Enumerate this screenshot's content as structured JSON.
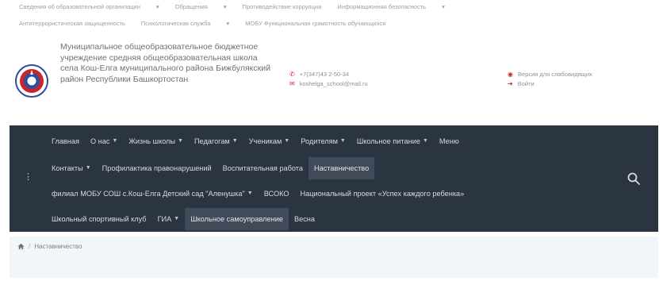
{
  "top_links": {
    "row1": [
      "Сведения об образовательной организации",
      "Обращения",
      "Противодействие коррупции",
      "Информационная безопасность"
    ],
    "row2": [
      "Антитеррористическая защищенность",
      "Психологическая служба",
      "МОБУ Функциональная грамотность обучающихся"
    ]
  },
  "header": {
    "org_name": "Муниципальное общеобразовательное бюджетное учреждение средняя общеобразовательная школа села Кош-Елга муниципального района Бижбулякский район Республики Башкортостан",
    "phone": "+7(347)43 2-50-34",
    "email": "koshelga_school@mail.ru",
    "links": [
      "Версия для слабовидящих",
      "Войти"
    ],
    "accent": "#c8262c"
  },
  "nav": {
    "background": "#2b3441",
    "row1": [
      {
        "label": "Главная",
        "caret": false
      },
      {
        "label": "О нас",
        "caret": true
      },
      {
        "label": "Жизнь школы",
        "caret": true
      },
      {
        "label": "Педагогам",
        "caret": true
      },
      {
        "label": "Ученикам",
        "caret": true
      },
      {
        "label": "Родителям",
        "caret": true
      },
      {
        "label": "Школьное питание",
        "caret": true
      },
      {
        "label": "Меню",
        "caret": false
      }
    ],
    "row2": [
      {
        "label": "Контакты",
        "caret": true
      },
      {
        "label": "Профилактика правонарушений",
        "caret": false
      },
      {
        "label": "Воспитательная работа",
        "caret": false
      },
      {
        "label": "Наставничество",
        "caret": false,
        "active": true
      }
    ],
    "row3": [
      {
        "label": "филиал МОБУ СОШ с.Кош-Елга Детский сад \"Аленушка\"",
        "caret": true
      },
      {
        "label": "ВСОКО",
        "caret": false
      },
      {
        "label": "Национальный проект «Успех каждого ребенка»",
        "caret": false
      }
    ],
    "row4": [
      {
        "label": "Школьный спортивный клуб",
        "caret": false
      },
      {
        "label": "ГИА",
        "caret": true
      },
      {
        "label": "Школьное самоуправление",
        "caret": false,
        "active": true
      },
      {
        "label": "Весна",
        "caret": false
      }
    ],
    "search_icon": "search-icon",
    "menu_icon": "menu-icon"
  },
  "breadcrumb": {
    "home_icon": "home-icon",
    "separator": "/",
    "current": "Наставничество"
  }
}
